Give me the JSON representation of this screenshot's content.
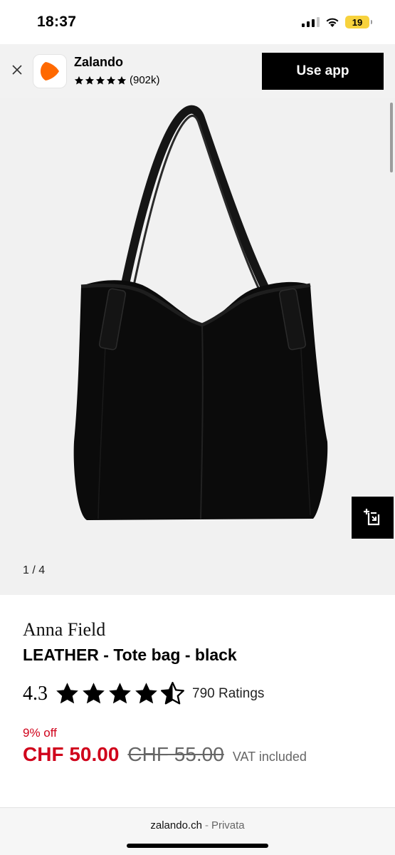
{
  "status_bar": {
    "time": "18:37",
    "battery": "19",
    "icons": [
      "cellular-signal-icon",
      "wifi-icon",
      "battery-icon"
    ]
  },
  "app_banner": {
    "close_icon": "close-icon",
    "app_name": "Zalando",
    "rating_stars": 5,
    "rating_count": "(902k)",
    "cta_label": "Use app",
    "brand_color": "#ff6900"
  },
  "gallery": {
    "counter": "1 / 4",
    "try_on_icon": "virtual-try-on-icon"
  },
  "product": {
    "brand": "Anna Field",
    "title": "LEATHER - Tote bag - black",
    "rating_value": "4.3",
    "rating_stars_filled": 4.3,
    "rating_count": "790 Ratings",
    "discount": "9% off",
    "price_current": "CHF 50.00",
    "price_original": "CHF 55.00",
    "vat_note": "VAT included",
    "sale_color": "#d0021b"
  },
  "browser": {
    "domain": "zalando.ch",
    "separator": "-",
    "mode": "Privata"
  }
}
